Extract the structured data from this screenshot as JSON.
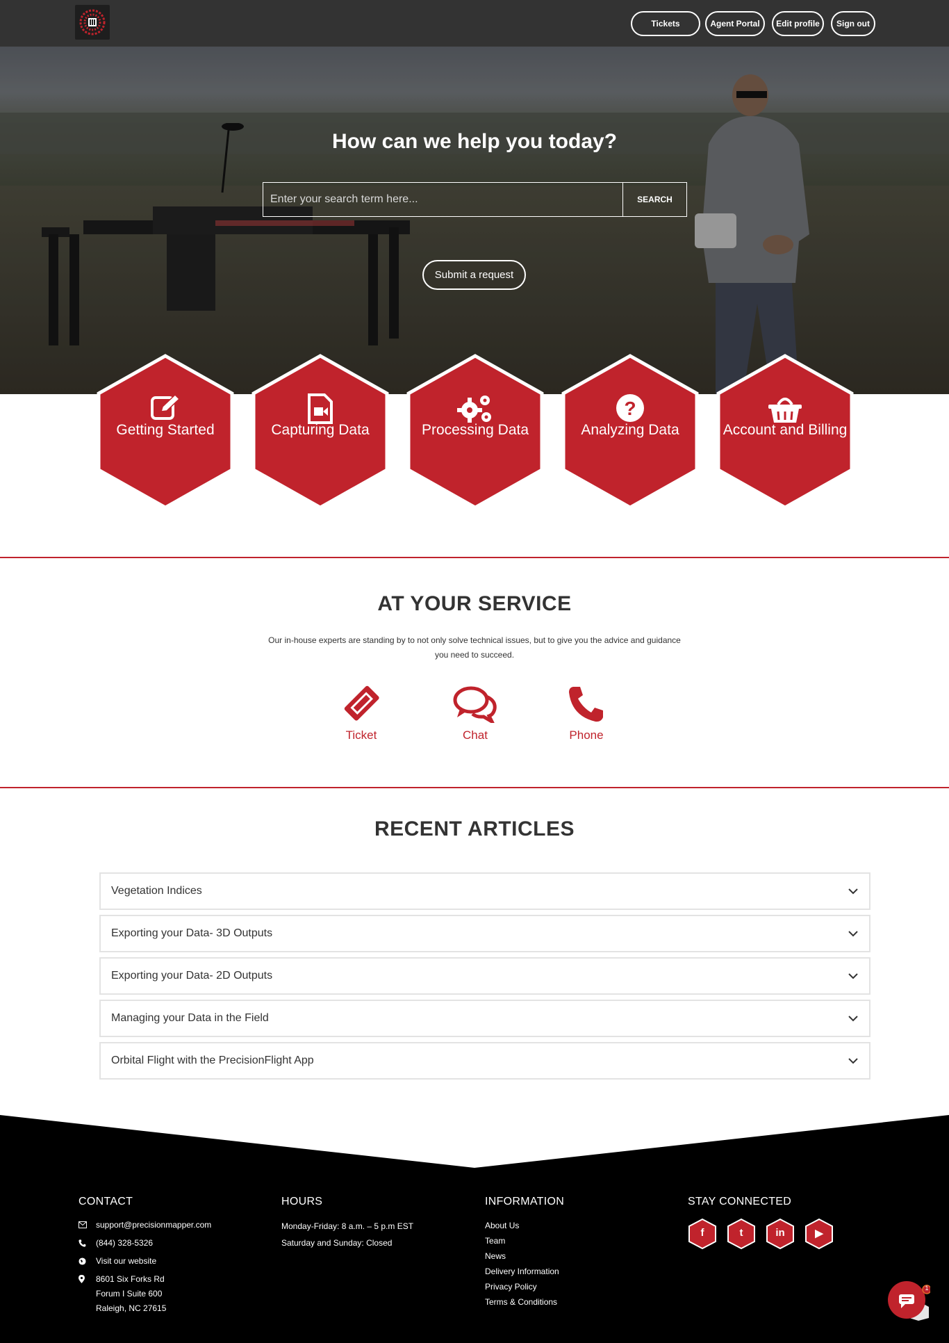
{
  "header": {
    "logo_alt": "PrecisionMapper logo",
    "nav": [
      "Tickets",
      "Agent Portal",
      "Edit profile",
      "Sign out"
    ]
  },
  "hero": {
    "title": "How can we help you today?",
    "search_placeholder": "Enter your search term here...",
    "search_button": "SEARCH",
    "submit_button": "Submit a request"
  },
  "categories": [
    {
      "label": "Getting Started",
      "icon": "edit-icon"
    },
    {
      "label": "Capturing Data",
      "icon": "video-file-icon"
    },
    {
      "label": "Processing Data",
      "icon": "gears-icon"
    },
    {
      "label": "Analyzing Data",
      "icon": "question-icon"
    },
    {
      "label": "Account and Billing",
      "icon": "basket-icon"
    }
  ],
  "service": {
    "title": "AT YOUR SERVICE",
    "text": "Our in-house experts are standing by to not only solve technical issues, but to give you the advice and guidance you need to succeed.",
    "items": [
      {
        "label": "Ticket",
        "icon": "ticket-icon"
      },
      {
        "label": "Chat",
        "icon": "chat-icon"
      },
      {
        "label": "Phone",
        "icon": "phone-icon"
      }
    ]
  },
  "articles": {
    "title": "RECENT ARTICLES",
    "items": [
      "Vegetation Indices",
      "Exporting your Data- 3D Outputs",
      "Exporting your Data- 2D Outputs",
      "Managing your Data in the Field",
      "Orbital Flight with the PrecisionFlight App"
    ]
  },
  "footer": {
    "contact": {
      "title": "CONTACT",
      "email": "support@precisionmapper.com",
      "phone": "(844) 328-5326",
      "website": "Visit our website",
      "address1": "8601 Six Forks Rd",
      "address2": "Forum I Suite 600",
      "address3": "Raleigh, NC 27615"
    },
    "hours": {
      "title": "HOURS",
      "line1": "Monday-Friday: 8 a.m. – 5 p.m EST",
      "line2": "Saturday and Sunday: Closed"
    },
    "information": {
      "title": "INFORMATION",
      "links": [
        "About Us",
        "Team",
        "News",
        "Delivery Information",
        "Privacy Policy",
        "Terms & Conditions"
      ]
    },
    "social": {
      "title": "STAY CONNECTED",
      "icons": [
        {
          "name": "facebook-icon",
          "glyph": "f"
        },
        {
          "name": "twitter-icon",
          "glyph": "t"
        },
        {
          "name": "linkedin-icon",
          "glyph": "in"
        },
        {
          "name": "youtube-icon",
          "glyph": "▶"
        }
      ]
    }
  },
  "chat_widget": {
    "badge": "1"
  },
  "colors": {
    "brand_red": "#c0232c",
    "header_bg": "#333333",
    "footer_bg": "#000000"
  }
}
